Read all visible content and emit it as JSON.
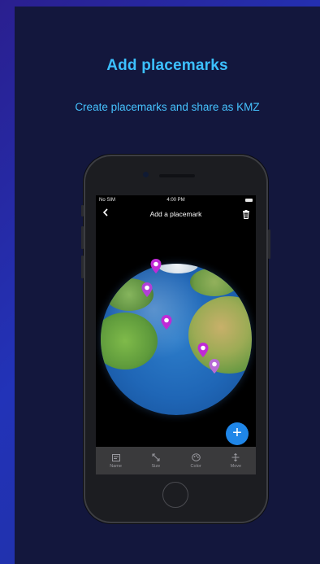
{
  "header": {
    "title": "Add placemarks",
    "subtitle": "Create placemarks and share as KMZ"
  },
  "phone": {
    "status": {
      "carrier": "No SIM",
      "time": "4:00 PM"
    },
    "nav": {
      "back_icon": "chevron-left-icon",
      "title": "Add a placemark",
      "trash_icon": "trash-icon"
    },
    "pins": [
      {
        "name": "pin-1",
        "color": "#c02ad6"
      },
      {
        "name": "pin-2",
        "color": "#b240d6"
      },
      {
        "name": "pin-3",
        "color": "#c02ad6"
      },
      {
        "name": "pin-4",
        "color": "#c02ad6"
      },
      {
        "name": "pin-5",
        "color": "#b76bd6"
      }
    ],
    "fab_label": "+",
    "tabs": [
      {
        "label": "Name",
        "icon": "name-icon"
      },
      {
        "label": "Size",
        "icon": "resize-icon"
      },
      {
        "label": "Color",
        "icon": "color-palette-icon"
      },
      {
        "label": "Move",
        "icon": "move-icon"
      }
    ]
  },
  "colors": {
    "accent": "#3cc0ff",
    "background": "#13173d",
    "fab": "#1f86e8"
  }
}
